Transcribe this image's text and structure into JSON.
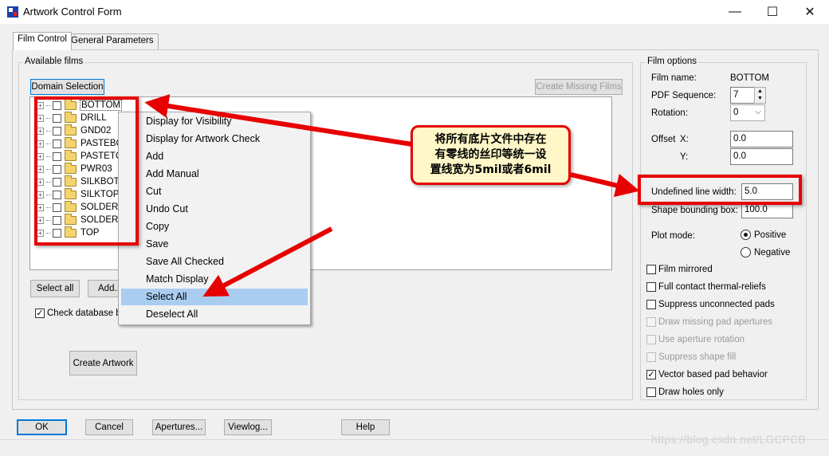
{
  "window": {
    "title": "Artwork Control Form",
    "minimize_glyph": "—",
    "maximize_glyph": "☐",
    "close_glyph": "✕"
  },
  "tabs": [
    {
      "label": "Film Control",
      "active": true
    },
    {
      "label": "General Parameters",
      "active": false
    }
  ],
  "available_films": {
    "group_title": "Available films",
    "domain_selection_label": "Domain Selection",
    "create_missing_films_label": "Create Missing Films",
    "films": [
      {
        "name": "BOTTOM",
        "selected": true
      },
      {
        "name": "DRILL"
      },
      {
        "name": "GND02"
      },
      {
        "name": "PASTEBC"
      },
      {
        "name": "PASTETC"
      },
      {
        "name": "PWR03"
      },
      {
        "name": "SILKBOTT"
      },
      {
        "name": "SILKTOP"
      },
      {
        "name": "SOLDERB"
      },
      {
        "name": "SOLDERT"
      },
      {
        "name": "TOP"
      }
    ],
    "select_all_label": "Select all",
    "add_label": "Add...",
    "check_database_label": "Check database b",
    "check_database_checked": true,
    "create_artwork_label": "Create Artwork"
  },
  "context_menu": {
    "items": [
      "Display for Visibility",
      "Display for Artwork Check",
      "Add",
      "Add Manual",
      "Cut",
      "Undo Cut",
      "Copy",
      "Save",
      "Save All Checked",
      "Match Display",
      "Select All",
      "Deselect All"
    ],
    "highlighted": "Select All"
  },
  "film_options": {
    "group_title": "Film options",
    "film_name_label": "Film name:",
    "film_name_value": "BOTTOM",
    "pdf_sequence_label": "PDF Sequence:",
    "pdf_sequence_value": "7",
    "rotation_label": "Rotation:",
    "rotation_value": "0",
    "offset_label": "Offset",
    "offset_x_label": "X:",
    "offset_x_value": "0.0",
    "offset_y_label": "Y:",
    "offset_y_value": "0.0",
    "undefined_line_width_label": "Undefined line width:",
    "undefined_line_width_value": "5.0",
    "shape_bounding_box_label": "Shape bounding box:",
    "shape_bounding_box_value": "100.0",
    "plot_mode_label": "Plot mode:",
    "plot_mode_options": [
      "Positive",
      "Negative"
    ],
    "plot_mode_selected": "Positive",
    "checkboxes": [
      {
        "label": "Film mirrored",
        "checked": false,
        "enabled": true
      },
      {
        "label": "Full contact thermal-reliefs",
        "checked": false,
        "enabled": true
      },
      {
        "label": "Suppress unconnected pads",
        "checked": false,
        "enabled": true
      },
      {
        "label": "Draw missing pad apertures",
        "checked": false,
        "enabled": false
      },
      {
        "label": "Use aperture rotation",
        "checked": false,
        "enabled": false
      },
      {
        "label": "Suppress shape fill",
        "checked": false,
        "enabled": false
      },
      {
        "label": "Vector based pad behavior",
        "checked": true,
        "enabled": true
      },
      {
        "label": "Draw holes only",
        "checked": false,
        "enabled": true
      }
    ]
  },
  "footer": {
    "ok_label": "OK",
    "cancel_label": "Cancel",
    "apertures_label": "Apertures...",
    "viewlog_label": "Viewlog...",
    "help_label": "Help"
  },
  "annotation": {
    "callout_line1": "将所有底片文件中存在",
    "callout_line2": "有零线的丝印等统一设",
    "callout_line3": "置线宽为5mil或者6mil",
    "color": "#e60000"
  },
  "watermark": "https://blog.csdn.net/LGCPCB",
  "colors": {
    "menu_highlight": "#a9cdf0",
    "callout_background": "#fff7c8",
    "focus_border": "#0078d7"
  }
}
